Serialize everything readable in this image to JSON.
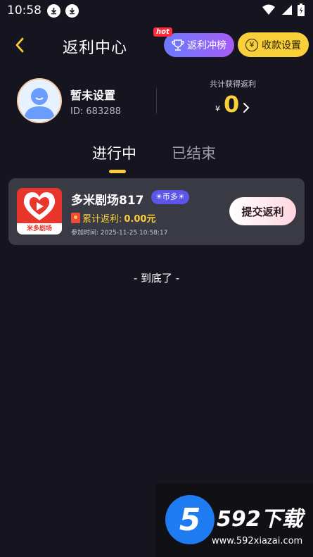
{
  "status_bar": {
    "time": "10:58"
  },
  "header": {
    "title": "返利中心",
    "hot_tag": "hot",
    "rank_button": "返利冲榜",
    "pay_settings_button": "收款设置"
  },
  "profile": {
    "nickname": "暂未设置",
    "user_id": "ID: 683288",
    "total_label": "共计获得返利",
    "currency": "¥",
    "total_value": "0"
  },
  "tabs": [
    {
      "label": "进行中",
      "active": true
    },
    {
      "label": "已结束",
      "active": false
    }
  ],
  "card": {
    "app_name": "多米剧场817",
    "logo_caption": "米多剧场",
    "coin_badge": "☀币多☀",
    "reward_label": "累计返利:",
    "reward_value": "0.00元",
    "join_time": "参加时间: 2025-11-25 10:58:17",
    "submit_button": "提交返利"
  },
  "list_end_text": "- 到底了 -",
  "watermark": {
    "logo_digit": "5",
    "brand": "592下载",
    "url": "www.592xiazai.com"
  },
  "colors": {
    "background": "#15141f",
    "accent_yellow": "#f9cf3a",
    "card_bg": "#3a3a45",
    "badge_purple": "#5b55e8"
  }
}
